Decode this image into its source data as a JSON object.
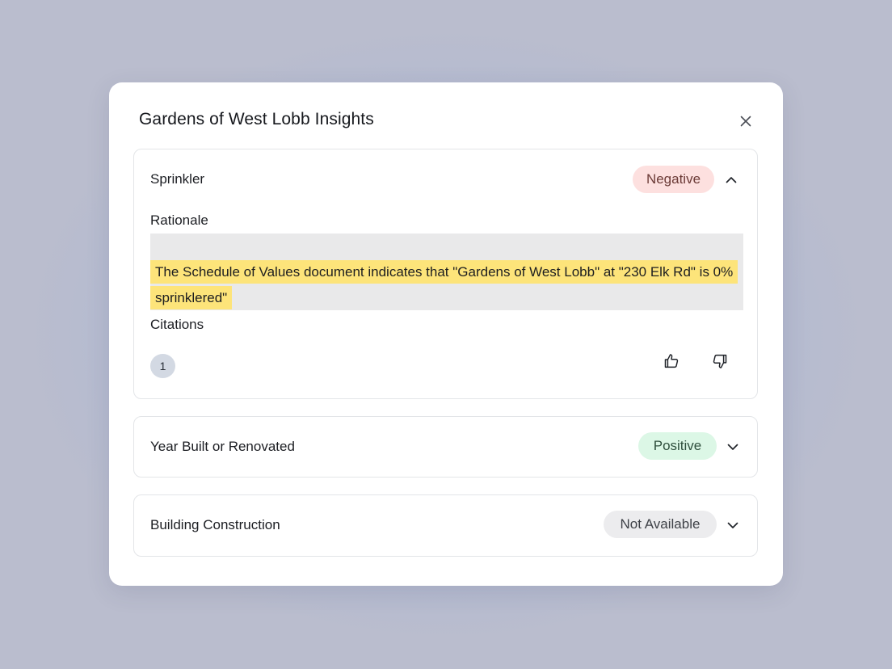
{
  "modal": {
    "title": "Gardens of West Lobb Insights"
  },
  "insights": [
    {
      "title": "Sprinkler",
      "status": "Negative",
      "expanded": true,
      "rationale_label": "Rationale",
      "rationale_text": "The Schedule of Values document indicates that \"Gardens of West Lobb\" at \"230 Elk Rd\" is 0% sprinklered\"",
      "citations_label": "Citations",
      "citations": [
        "1"
      ]
    },
    {
      "title": "Year Built or Renovated",
      "status": "Positive",
      "expanded": false
    },
    {
      "title": "Building Construction",
      "status": "Not Available",
      "expanded": false
    }
  ],
  "icons": {
    "close": "close-icon",
    "collapse": "chevron-up-icon",
    "expand": "chevron-down-icon",
    "thumbs_up": "thumbs-up-icon",
    "thumbs_down": "thumbs-down-icon"
  },
  "colors": {
    "negative_bg": "#fde0df",
    "positive_bg": "#dcf7e6",
    "not_available_bg": "#ececee",
    "highlight": "#fde47a"
  }
}
